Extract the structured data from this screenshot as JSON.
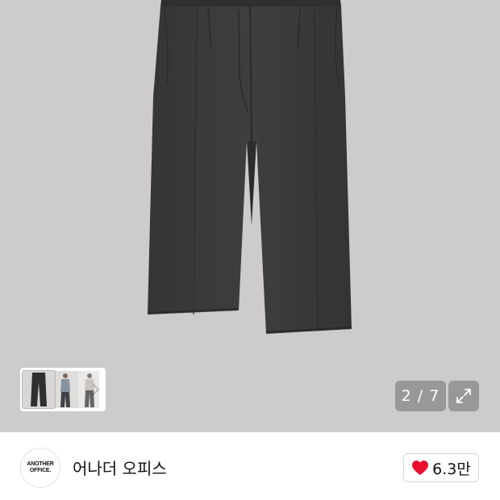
{
  "gallery": {
    "background_color": "#cdcccb",
    "product_color": "#3a3a39",
    "current_index": 2,
    "total_images": 7,
    "counter_text": "2 / 7",
    "thumbnail_count_visible": 3,
    "next_icon": "chevron-right-icon",
    "expand_icon": "expand-icon"
  },
  "store": {
    "logo_lines": [
      "ANOTHER",
      "OFFICE."
    ],
    "name": "어나더 오피스",
    "likes": "6.3만",
    "like_icon": "heart-icon",
    "like_color": "#e8112d"
  }
}
